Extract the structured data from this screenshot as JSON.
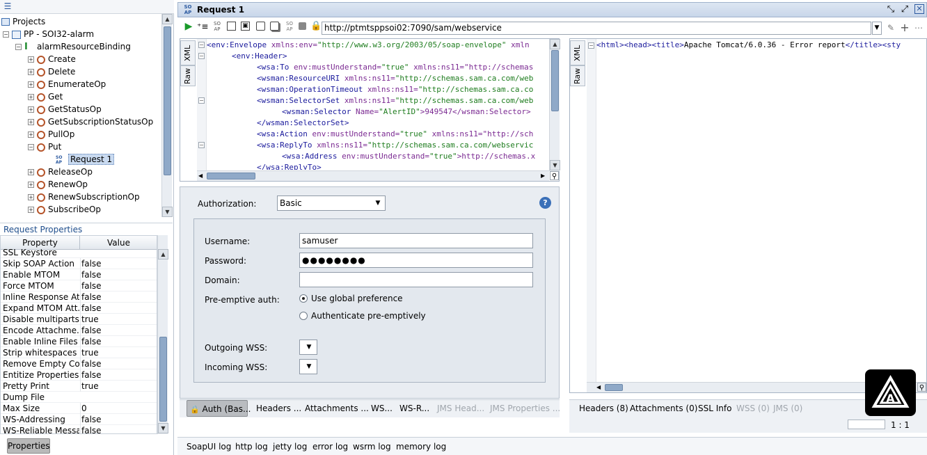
{
  "left": {
    "projects_label": "Projects",
    "project_name": "PP - SOI32-alarm",
    "binding_name": "alarmResourceBinding",
    "operations": [
      "Create",
      "Delete",
      "EnumerateOp",
      "Get",
      "GetStatusOp",
      "GetSubscriptionStatusOp",
      "PullOp",
      "Put"
    ],
    "selected_request": "Request 1",
    "more_operations": [
      "ReleaseOp",
      "RenewOp",
      "RenewSubscriptionOp",
      "SubscribeOp"
    ],
    "request_properties_title": "Request Properties",
    "prop_col_header": "Property",
    "value_col_header": "Value",
    "properties": [
      {
        "name": "SSL Keystore",
        "value": ""
      },
      {
        "name": "Skip SOAP Action",
        "value": "false"
      },
      {
        "name": "Enable MTOM",
        "value": "false"
      },
      {
        "name": "Force MTOM",
        "value": "false"
      },
      {
        "name": "Inline Response Att...",
        "value": "false"
      },
      {
        "name": "Expand MTOM Att...",
        "value": "false"
      },
      {
        "name": "Disable multiparts",
        "value": "true"
      },
      {
        "name": "Encode Attachme...",
        "value": "false"
      },
      {
        "name": "Enable Inline Files",
        "value": "false"
      },
      {
        "name": "Strip whitespaces",
        "value": "true"
      },
      {
        "name": "Remove Empty Co...",
        "value": "false"
      },
      {
        "name": "Entitize Properties",
        "value": "false"
      },
      {
        "name": "Pretty Print",
        "value": "true"
      },
      {
        "name": "Dump File",
        "value": ""
      },
      {
        "name": "Max Size",
        "value": "0"
      },
      {
        "name": "WS-Addressing",
        "value": "false"
      },
      {
        "name": "WS-Reliable Messa...",
        "value": "false"
      }
    ],
    "properties_button": "Properties"
  },
  "request": {
    "title": "Request 1",
    "url": "http://ptmtsppsoi02:7090/sam/webservice",
    "side_tabs": [
      "XML",
      "Raw"
    ],
    "xml_lines": [
      {
        "tag": "<env:Envelope",
        "att": " xmlns:env=",
        "val": "\"http://www.w3.org/2003/05/soap-envelope\"",
        "rest": " xmln"
      },
      {
        "tag": "<env:Header>",
        "att": "",
        "val": "",
        "rest": ""
      },
      {
        "tag": "<wsa:To",
        "att": " env:mustUnderstand=",
        "val": "\"true\"",
        "rest": " xmlns:ns11=\"http://schemas"
      },
      {
        "tag": "<wsman:ResourceURI",
        "att": " xmlns:ns11=",
        "val": "\"http://schemas.sam.ca.com/web",
        "rest": ""
      },
      {
        "tag": "<wsman:OperationTimeout",
        "att": " xmlns:ns11=",
        "val": "\"http://schemas.sam.ca.co",
        "rest": ""
      },
      {
        "tag": "<wsman:SelectorSet",
        "att": " xmlns:ns11=",
        "val": "\"http://schemas.sam.ca.com/web",
        "rest": ""
      },
      {
        "tag": "<wsman:Selector",
        "att": " Name=",
        "val": "\"AlertID\"",
        "rest": ">949547</wsman:Selector>"
      },
      {
        "tag": "</wsman:SelectorSet>",
        "att": "",
        "val": "",
        "rest": ""
      },
      {
        "tag": "<wsa:Action",
        "att": " env:mustUnderstand=",
        "val": "\"true\"",
        "rest": " xmlns:ns11=\"http://sch"
      },
      {
        "tag": "<wsa:ReplyTo",
        "att": " xmlns:ns11=",
        "val": "\"http://schemas.sam.ca.com/webservic",
        "rest": ""
      },
      {
        "tag": "<wsa:Address",
        "att": " env:mustUnderstand=",
        "val": "\"true\"",
        "rest": ">http://schemas.x"
      },
      {
        "tag": "</wsa:ReplyTo>",
        "att": "",
        "val": "",
        "rest": ""
      }
    ],
    "auth_label": "Authorization:",
    "auth_value": "Basic",
    "username_label": "Username:",
    "username_value": "samuser",
    "password_label": "Password:",
    "password_value": "●●●●●●●●",
    "domain_label": "Domain:",
    "domain_value": "",
    "preemptive_label": "Pre-emptive auth:",
    "radio_global": "Use global preference",
    "radio_preemptive": "Authenticate pre-emptively",
    "outgoing_label": "Outgoing WSS:",
    "incoming_label": "Incoming WSS:",
    "tabs": [
      "Auth (Bas...",
      "Headers ...",
      "Attachments ...",
      "WS...",
      "WS-R...",
      "JMS Head...",
      "JMS Properties ..."
    ]
  },
  "response": {
    "side_tabs": [
      "XML",
      "Raw"
    ],
    "line": {
      "open": "<html><head><title>",
      "text": "Apache Tomcat/6.0.36 - Error report",
      "close": "</title><sty"
    },
    "tabs": [
      "Headers (8)",
      "Attachments (0)",
      "SSL Info",
      "WSS (0)",
      "JMS (0)"
    ],
    "position": "1 : 1"
  },
  "logs": [
    "SoapUI log",
    "http log",
    "jetty log",
    "error log",
    "wsrm log",
    "memory log"
  ]
}
